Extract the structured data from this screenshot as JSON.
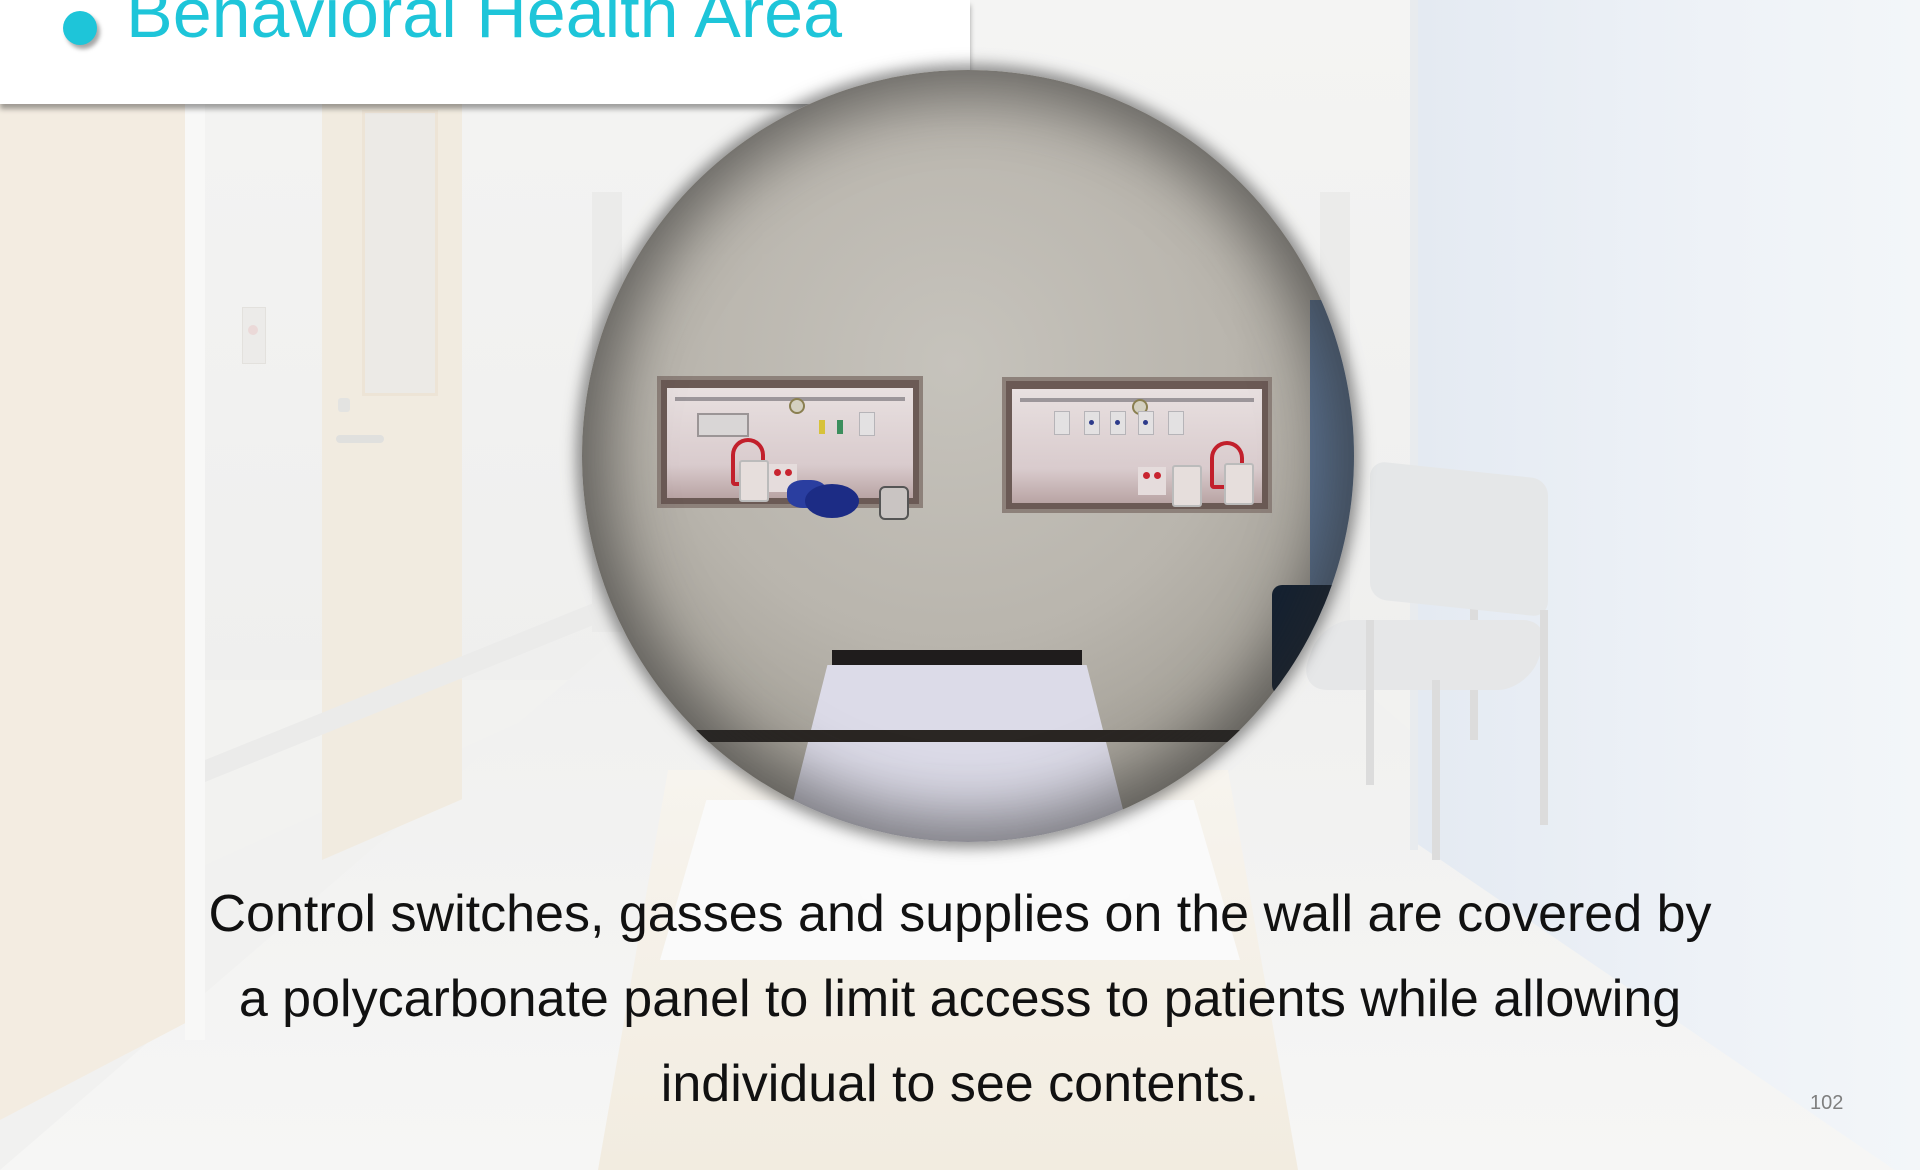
{
  "slide": {
    "title": "Behavioral Health Area",
    "caption": "Control switches, gasses and supplies on the wall are covered by a polycarbonate panel to limit access to patients while allowing individual to see contents.",
    "page_number": "102",
    "accent_color": "#1ec5d9"
  },
  "images": {
    "background": "faded-hospital-room-photo",
    "inset": "circular-magnified-wall-niches-photo"
  }
}
